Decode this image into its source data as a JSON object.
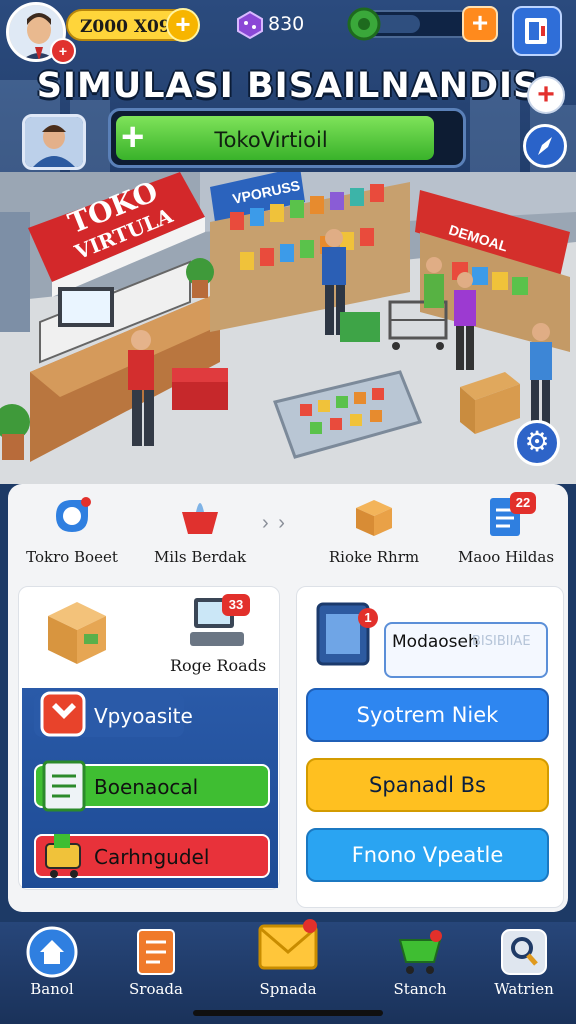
{
  "hud": {
    "coins": "Z000 X090",
    "gems": "830",
    "energy_level": 0.55,
    "avatar_badge": "+",
    "coin_plus": "+",
    "energy_plus": "+"
  },
  "title": "SIMULASI BISAILNANDIS",
  "progress": {
    "label": "TokoVirtioil",
    "fill_fraction": 0.93
  },
  "side_buttons": {
    "plus": "+",
    "compass_icon": "compass-icon"
  },
  "scene": {
    "store_sign_line1": "TOKO",
    "store_sign_line2": "VIRTULA",
    "booth_sign": "VPORUSS",
    "stall_sign": "DEMOAL",
    "gear_icon": "gear-icon"
  },
  "quick_actions": [
    {
      "label": "Tokro Boeet",
      "icon": "tag-icon"
    },
    {
      "label": "Mils Berdak",
      "icon": "basket-icon"
    },
    {
      "label": "Rioke Rhrm",
      "icon": "box-icon"
    },
    {
      "label": "Maoo Hildas",
      "icon": "document-icon",
      "badge": "22"
    }
  ],
  "quick_arrows": "› ›",
  "left_card": {
    "image_label": "Roge Roads",
    "image_badge": "33",
    "buttons": [
      {
        "label": "Vpyoasite",
        "icon": "shield-icon",
        "color": "#e8432b"
      },
      {
        "label": "Boenaocal",
        "icon": "ledger-icon",
        "color": "#3fbe32"
      },
      {
        "label": "Carhngudel",
        "icon": "cart-icon",
        "color": "#e8323a"
      }
    ]
  },
  "right_card": {
    "notice_text": "Modaoseh",
    "notice_sub": "BISIBIIAE",
    "notice_badge": "1",
    "buttons": [
      {
        "label": "Syotrem Niek",
        "color": "#2e86f0"
      },
      {
        "label": "Spanadl Bs",
        "color": "#ffc020"
      },
      {
        "label": "Fnono Vpeatle",
        "color": "#2aa4f2"
      }
    ]
  },
  "nav": [
    {
      "label": "Banol",
      "icon": "home-icon"
    },
    {
      "label": "Sroada",
      "icon": "report-icon"
    },
    {
      "label": "Spnada",
      "icon": "mail-icon"
    },
    {
      "label": "Stanch",
      "icon": "shopping-cart-icon"
    },
    {
      "label": "Watrien",
      "icon": "search-icon"
    }
  ]
}
